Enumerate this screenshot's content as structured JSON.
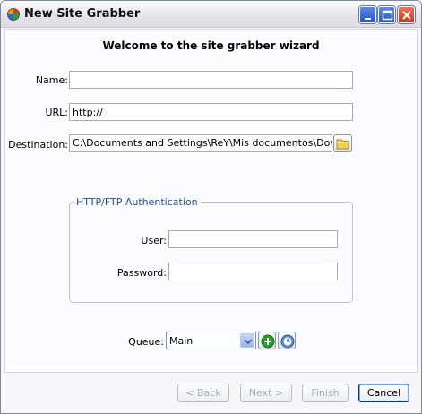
{
  "window": {
    "title": "New Site Grabber"
  },
  "wizard": {
    "heading": "Welcome to the site grabber wizard"
  },
  "form": {
    "name": {
      "label": "Name:",
      "value": ""
    },
    "url": {
      "label": "URL:",
      "value": "http://"
    },
    "destination": {
      "label": "Destination:",
      "value": "C:\\Documents and Settings\\ReY\\Mis documentos\\Downloads"
    }
  },
  "auth": {
    "title": "HTTP/FTP Authentication",
    "user": {
      "label": "User:",
      "value": ""
    },
    "password": {
      "label": "Password:",
      "value": ""
    }
  },
  "queue": {
    "label": "Queue:",
    "selected": "Main"
  },
  "buttons": {
    "back": "< Back",
    "next": "Next >",
    "finish": "Finish",
    "cancel": "Cancel"
  },
  "colors": {
    "group_title": "#1f4fb0",
    "titlebar_close": "#c5381a",
    "titlebar_buttons": "#2654d1",
    "add_icon": "#2a9d2a"
  },
  "icons": [
    "app-icon",
    "minimize-icon",
    "maximize-icon",
    "close-icon",
    "folder-icon",
    "chevron-down-icon",
    "add-icon",
    "schedule-icon"
  ]
}
